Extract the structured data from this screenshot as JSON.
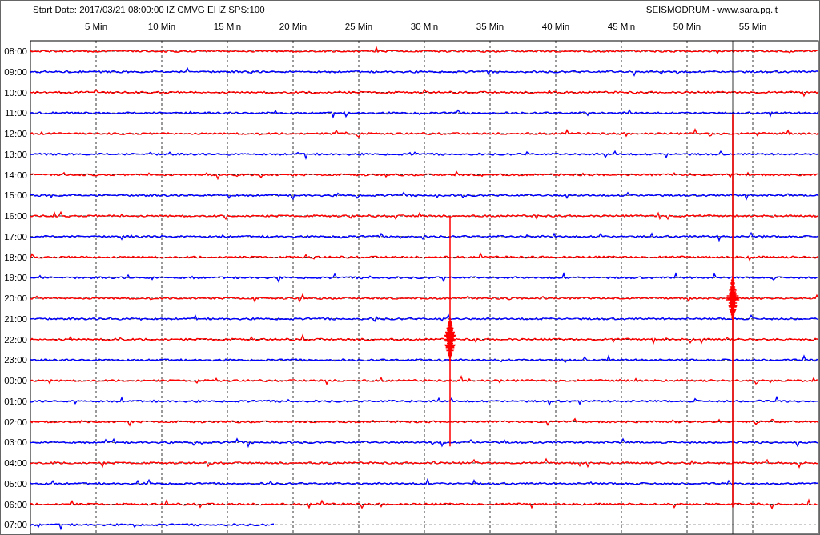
{
  "header": {
    "start_info": "Start Date: 2017/03/21 08:00:00 IZ CMVG EHZ SPS:100",
    "source": "SEISMODRUM - www.sara.pg.it"
  },
  "minute_labels": [
    "5 Min",
    "10 Min",
    "15 Min",
    "20 Min",
    "25 Min",
    "30 Min",
    "35 Min",
    "40 Min",
    "45 Min",
    "50 Min",
    "55 Min"
  ],
  "rows": [
    {
      "time": "08:00",
      "color": "#ff0000",
      "partial": false
    },
    {
      "time": "09:00",
      "color": "#0000ff",
      "partial": false
    },
    {
      "time": "10:00",
      "color": "#ff0000",
      "partial": false
    },
    {
      "time": "11:00",
      "color": "#0000ff",
      "partial": false
    },
    {
      "time": "12:00",
      "color": "#ff0000",
      "partial": false
    },
    {
      "time": "13:00",
      "color": "#0000ff",
      "partial": false
    },
    {
      "time": "14:00",
      "color": "#ff0000",
      "partial": false
    },
    {
      "time": "15:00",
      "color": "#0000ff",
      "partial": false
    },
    {
      "time": "16:00",
      "color": "#ff0000",
      "partial": false
    },
    {
      "time": "17:00",
      "color": "#0000ff",
      "partial": false
    },
    {
      "time": "18:00",
      "color": "#ff0000",
      "partial": false
    },
    {
      "time": "19:00",
      "color": "#0000ff",
      "partial": false
    },
    {
      "time": "20:00",
      "color": "#ff0000",
      "partial": false
    },
    {
      "time": "21:00",
      "color": "#0000ff",
      "partial": false
    },
    {
      "time": "22:00",
      "color": "#ff0000",
      "partial": false
    },
    {
      "time": "23:00",
      "color": "#0000ff",
      "partial": false
    },
    {
      "time": "00:00",
      "color": "#ff0000",
      "partial": false
    },
    {
      "time": "01:00",
      "color": "#0000ff",
      "partial": false
    },
    {
      "time": "02:00",
      "color": "#ff0000",
      "partial": false
    },
    {
      "time": "03:00",
      "color": "#0000ff",
      "partial": false
    },
    {
      "time": "04:00",
      "color": "#ff0000",
      "partial": false
    },
    {
      "time": "05:00",
      "color": "#0000ff",
      "partial": false
    },
    {
      "time": "06:00",
      "color": "#ff0000",
      "partial": false
    },
    {
      "time": "07:00",
      "color": "#0000ff",
      "partial": true
    }
  ]
}
